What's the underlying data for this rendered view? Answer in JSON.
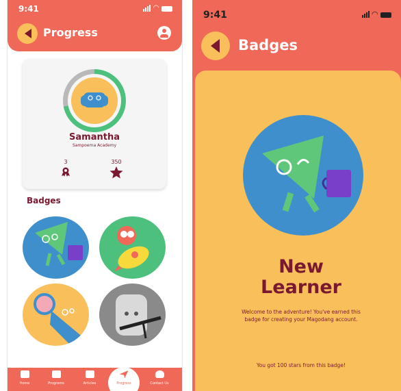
{
  "status": {
    "time": "9:41"
  },
  "progress_screen": {
    "title": "Progress",
    "profile": {
      "name": "Samantha",
      "school": "Sampoerna Academy",
      "badges_count": "3",
      "stars_count": "350",
      "level_progress": 0.72
    },
    "badges_heading": "Badges",
    "badges": [
      {
        "icon": "triangle-backpack-icon"
      },
      {
        "icon": "rocket-creature-icon"
      },
      {
        "icon": "magnifier-creature-icon"
      },
      {
        "icon": "square-robot-icon"
      }
    ],
    "nav": [
      {
        "label": "Home",
        "icon": "home-icon"
      },
      {
        "label": "Programs",
        "icon": "programs-icon"
      },
      {
        "label": "Articles",
        "icon": "articles-icon"
      },
      {
        "label": "Progress",
        "icon": "progress-icon",
        "active": true
      },
      {
        "label": "Contact Us",
        "icon": "headset-icon"
      }
    ]
  },
  "badge_screen": {
    "title": "Badges",
    "badge_title_line1": "New",
    "badge_title_line2": "Learner",
    "description": "Welcome to the adventure! You've earned this badge for creating your Magodang account.",
    "stars_note": "You got 100 stars from this badge!"
  },
  "colors": {
    "header": "#f06857",
    "accent": "#f8bf5b",
    "text": "#7a1830",
    "progress_ring": "#4cc07c"
  }
}
